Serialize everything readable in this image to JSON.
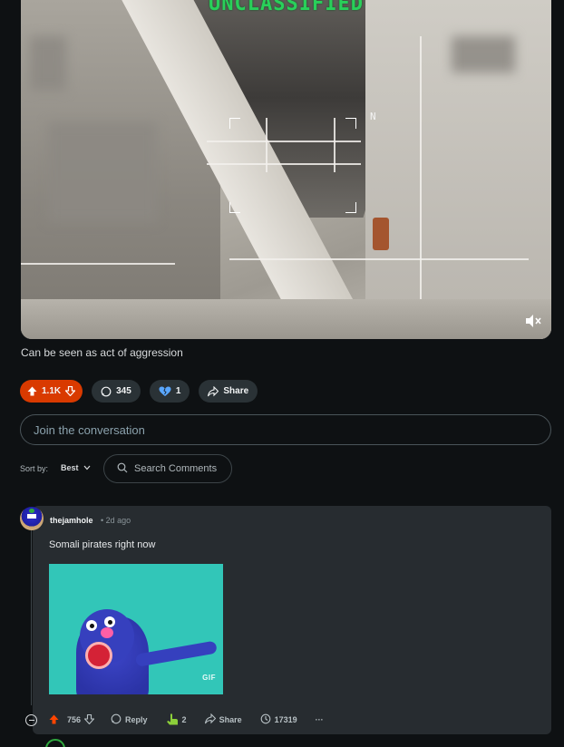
{
  "video": {
    "classification_label": "UNCLASSIFIED",
    "hud_marker": "N",
    "mute_icon": "muted-speaker-icon"
  },
  "post": {
    "caption": "Can be seen as act of aggression",
    "upvotes": "1.1K",
    "comments": "345",
    "awards": "1",
    "share_label": "Share",
    "colors": {
      "vote_pill": "#d93a00",
      "pill_bg": "#2a3236"
    }
  },
  "composer": {
    "placeholder": "Join the conversation"
  },
  "sort": {
    "label": "Sort by:",
    "value": "Best",
    "search_placeholder": "Search Comments"
  },
  "comment": {
    "username": "thejamhole",
    "time_ago": "• 2d ago",
    "text": "Somali pirates right now",
    "gif_label": "GIF",
    "score": "756",
    "reply_label": "Reply",
    "award_count": "2",
    "share_label": "Share",
    "view_count": "17319",
    "more_label": "···"
  }
}
